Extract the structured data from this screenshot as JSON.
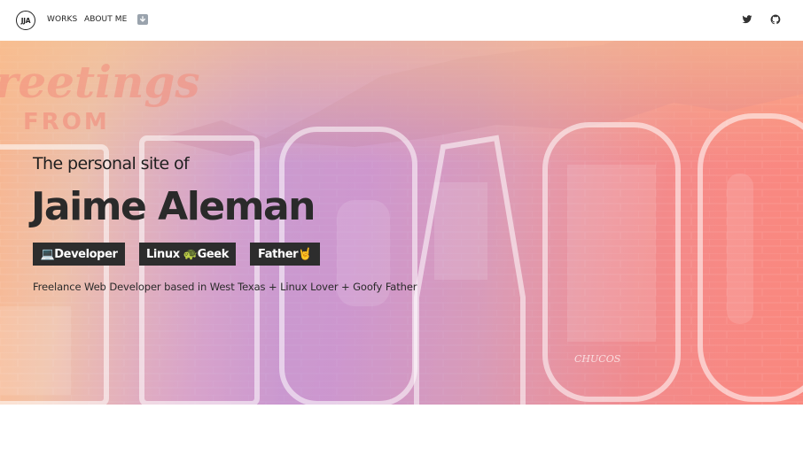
{
  "nav": {
    "logo_text": "JJA",
    "links": [
      "WORKS",
      "ABOUT ME"
    ],
    "download_icon": "down-arrow-icon",
    "social_icons": [
      "twitter-icon",
      "github-icon"
    ]
  },
  "hero": {
    "subtitle": "The personal site of",
    "title": "Jaime Aleman",
    "tags": [
      "💻Developer",
      "Linux 🐢Geek",
      "Father🤘"
    ],
    "tagline": "Freelance Web Developer based in West Texas + Linux Lover + Goofy Father",
    "background_text_top": "reetings",
    "background_text_from": "FROM",
    "background_letters": [
      "E",
      "L",
      "P",
      "A",
      "S",
      "O"
    ],
    "background_sign_text": "CHUCOS",
    "colors": {
      "gradient_start": "#f6b38f",
      "gradient_mid": "#f09dc3",
      "gradient_end": "#f9877e",
      "tag_bg": "#2d2d2d",
      "text_dark": "#222222"
    }
  }
}
